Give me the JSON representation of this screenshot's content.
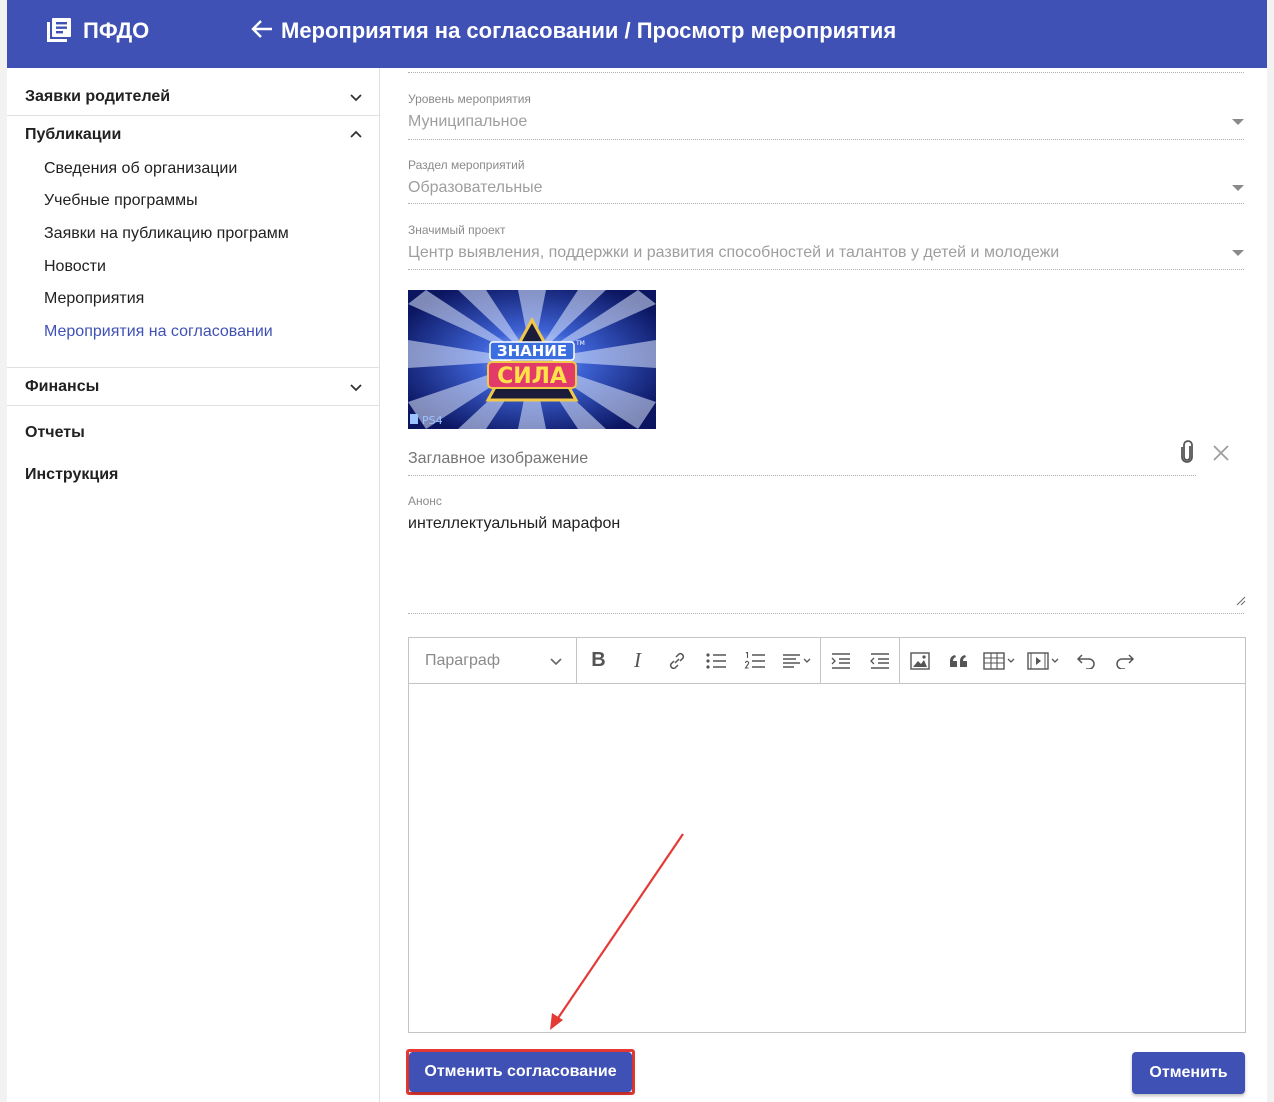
{
  "header": {
    "brand": "ПФДО",
    "title": "Мероприятия на согласовании / Просмотр мероприятия"
  },
  "sidebar": {
    "groups": [
      {
        "label": "Заявки родителей",
        "expanded": false
      },
      {
        "label": "Публикации",
        "expanded": true
      },
      {
        "label": "Финансы",
        "expanded": false
      },
      {
        "label": "Отчеты"
      },
      {
        "label": "Инструкция"
      }
    ],
    "publications": [
      {
        "label": "Сведения об организации"
      },
      {
        "label": "Учебные программы"
      },
      {
        "label": "Заявки на публикацию программ"
      },
      {
        "label": "Новости"
      },
      {
        "label": "Мероприятия"
      },
      {
        "label": "Мероприятия на согласовании",
        "active": true
      }
    ]
  },
  "form": {
    "level": {
      "label": "Уровень мероприятия",
      "value": "Муниципальное"
    },
    "section": {
      "label": "Раздел мероприятий",
      "value": "Образовательные"
    },
    "project": {
      "label": "Значимый проект",
      "value": "Центр выявления, поддержки и развития способностей и талантов у детей и молодежи"
    },
    "image": {
      "placeholder": "Заглавное изображение",
      "logo_top": "ЗНАНИЕ",
      "logo_tm": "TM",
      "logo_bottom": "СИЛА",
      "platform": "PS4"
    },
    "announce": {
      "label": "Анонс",
      "value": "интеллектуальный марафон"
    },
    "editor": {
      "format_select": "Параграф",
      "bold": "B",
      "italic": "I"
    }
  },
  "actions": {
    "cancel_approval": "Отменить согласование",
    "cancel": "Отменить"
  },
  "colors": {
    "primary": "#3f51b5",
    "active_nav": "#3f51b5",
    "highlight": "#e53935"
  }
}
